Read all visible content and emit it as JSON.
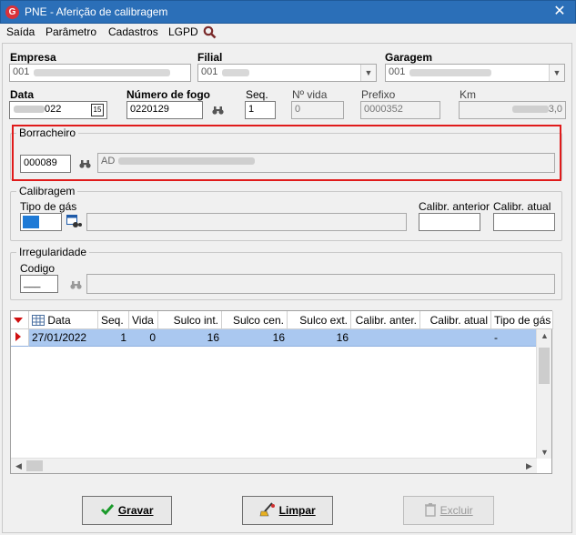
{
  "window": {
    "title": "PNE - Aferição de calibragem",
    "close": "✕",
    "app_icon": "G"
  },
  "menu": [
    "Saída",
    "Parâmetro",
    "Cadastros",
    "LGPD"
  ],
  "fields": {
    "empresa": {
      "label": "Empresa",
      "value": "001"
    },
    "filial": {
      "label": "Filial",
      "value": "001"
    },
    "garagem": {
      "label": "Garagem",
      "value": "001"
    },
    "data": {
      "label": "Data",
      "value": "022"
    },
    "numero_fogo": {
      "label": "Número de fogo",
      "value": "0220129"
    },
    "seq": {
      "label": "Seq.",
      "value": "1"
    },
    "n_vida": {
      "label": "Nº vida",
      "value": "0"
    },
    "prefixo": {
      "label": "Prefixo",
      "value": "0000352"
    },
    "km": {
      "label": "Km",
      "value": "3,0"
    }
  },
  "borracheiro": {
    "title": "Borracheiro",
    "code": "000089",
    "name": "AD"
  },
  "calibragem": {
    "title": "Calibragem",
    "tipo_gas_label": "Tipo de gás",
    "calib_anterior_label": "Calibr. anterior",
    "calib_atual_label": "Calibr. atual"
  },
  "irregularidade": {
    "title": "Irregularidade",
    "codigo_label": "Codigo",
    "codigo_value": "___"
  },
  "table": {
    "columns": [
      "Data",
      "Seq.",
      "Vida",
      "Sulco int.",
      "Sulco cen.",
      "Sulco ext.",
      "Calibr. anter.",
      "Calibr. atual",
      "Tipo de gás"
    ],
    "rows": [
      [
        "27/01/2022",
        "1",
        "0",
        "16",
        "16",
        "16",
        "",
        "",
        "-"
      ]
    ]
  },
  "buttons": {
    "gravar": "Gravar",
    "limpar": "Limpar",
    "excluir": "Excluir"
  },
  "colors": {
    "titlebar": "#2b6fb8",
    "highlight": "#e01b1b",
    "selected_row": "#aac8f0",
    "gravar_check": "#1a9a2a"
  }
}
